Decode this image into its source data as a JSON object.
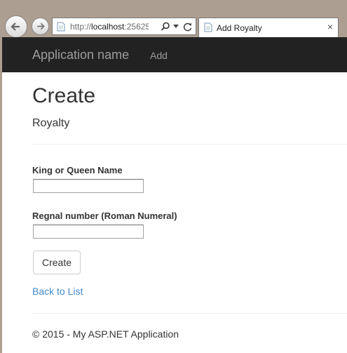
{
  "browser": {
    "url_prefix": "http://",
    "url_host": "localhost",
    "url_rest": ":25625/",
    "tab_title": "Add Royalty",
    "tab_close": "×"
  },
  "navbar": {
    "brand": "Application name",
    "links": [
      "Add"
    ]
  },
  "page": {
    "title": "Create",
    "subtitle": "Royalty"
  },
  "form": {
    "fields": [
      {
        "label": "King or Queen Name",
        "value": ""
      },
      {
        "label": "Regnal number (Roman Numeral)",
        "value": ""
      }
    ],
    "submit_label": "Create"
  },
  "back_link": "Back to List",
  "footer": "© 2015 - My ASP.NET Application"
}
